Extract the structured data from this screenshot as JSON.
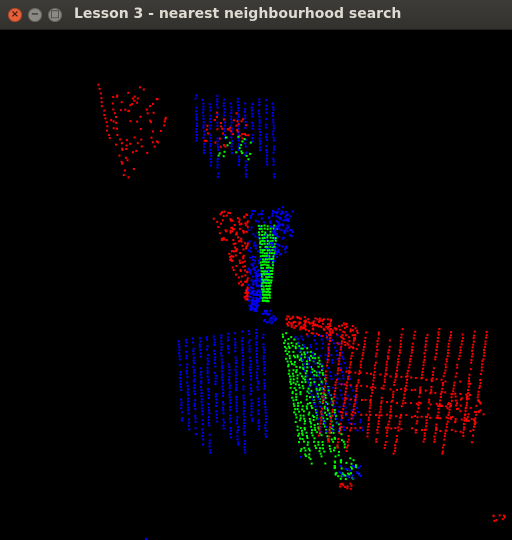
{
  "window": {
    "title": "Lesson 3 - nearest neighbourhood search",
    "controls": {
      "close_glyph": "×",
      "minimize_glyph": "−",
      "maximize_glyph": "□"
    }
  },
  "viewport": {
    "background": "#000000",
    "point_colors": {
      "red": "#ff0000",
      "green": "#00ff00",
      "blue": "#0000ff"
    }
  }
}
